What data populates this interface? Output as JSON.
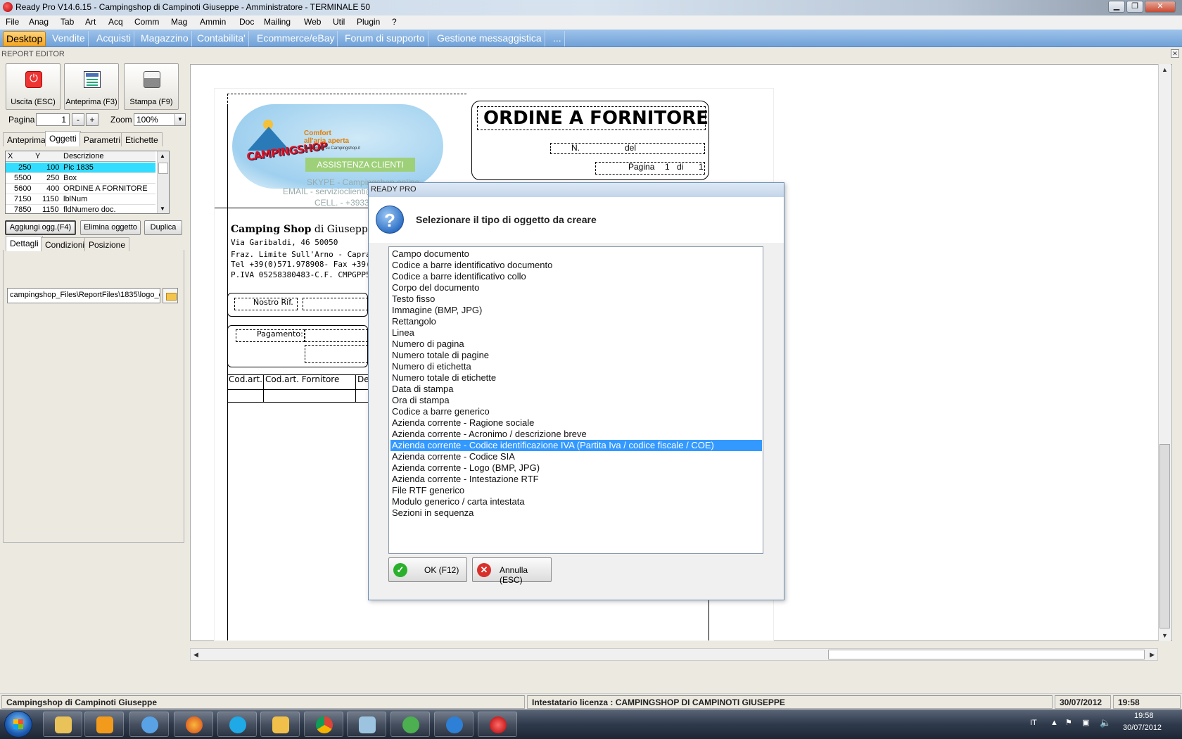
{
  "window": {
    "title": "Ready Pro V14.6.15 - Campingshop di Campinoti Giuseppe - Amministratore - TERMINALE 50"
  },
  "menubar": [
    "File",
    "Anag",
    "Tab",
    "Art",
    "Acq",
    "Comm",
    "Mag",
    "Ammin",
    "Doc",
    "Mailing",
    "Web",
    "Util",
    "Plugin",
    "?"
  ],
  "modules": [
    "Desktop",
    "Vendite",
    "Acquisti",
    "Magazzino",
    "Contabilita'",
    "Ecommerce/eBay",
    "Forum di supporto",
    "Gestione messaggistica",
    "..."
  ],
  "editor": {
    "label": "REPORT EDITOR"
  },
  "toolbar": {
    "exit": "Uscita (ESC)",
    "preview": "Anteprima (F3)",
    "print": "Stampa (F9)"
  },
  "pager": {
    "page_label": "Pagina",
    "page_value": "1",
    "minus": "-",
    "plus": "+",
    "zoom_label": "Zoom",
    "zoom_value": "100%"
  },
  "left_tabs": [
    "Anteprima",
    "Oggetti",
    "Parametri",
    "Etichette"
  ],
  "objects_grid": {
    "headers": [
      "X",
      "Y",
      "Descrizione"
    ],
    "rows": [
      {
        "x": "250",
        "y": "100",
        "desc": "Pic 1835"
      },
      {
        "x": "5500",
        "y": "250",
        "desc": "Box"
      },
      {
        "x": "5600",
        "y": "400",
        "desc": "ORDINE A FORNITORE"
      },
      {
        "x": "7150",
        "y": "1150",
        "desc": "lblNum"
      },
      {
        "x": "7850",
        "y": "1150",
        "desc": "fldNumero doc."
      }
    ]
  },
  "object_buttons": {
    "add": "Aggiungi ogg.(F4)",
    "delete": "Elimina oggetto",
    "dup": "Duplica"
  },
  "detail_tabs": [
    "Dettagli",
    "Condizioni",
    "Posizione"
  ],
  "path_value": "campingshop_Files\\ReportFiles\\1835\\logo_c",
  "report": {
    "title": "ORDINE A FORNITORE",
    "n_label": "N.",
    "del_label": "del",
    "pagina_label": "Pagina",
    "page_num": "1",
    "di_label": "di",
    "page_total": "1",
    "logo_word": "CAMPINGSHOP",
    "comfort": "Comfort\nall'aria aperta",
    "benvenuto": "Benvenuto su Campingshop.it",
    "assist": "ASSISTENZA CLIENTI",
    "skype": "SKYPE - Campingshop.online",
    "email": "EMAIL - servizioclienti@",
    "cell": "CELL. - +3933",
    "company_bold": "Camping Shop",
    "company_rest": " di Giuseppe C",
    "addr1": "Via Garibaldi, 46 50050",
    "addr2": "Fraz. Limite Sull'Arno - Capraia e Lin",
    "addr3": "Tel +39(0)571.978908- Fax +39(0)57",
    "addr4": "P.IVA 05258380483-C.F. CMPGPP59",
    "nostro_rif": "Nostro Rif.",
    "pagamento": "Pagamento:",
    "col1": "Cod.art.",
    "col2": "Cod.art. Fornitore",
    "col3": "De"
  },
  "dialog": {
    "title": "READY PRO",
    "message": "Selezionare il tipo di oggetto da creare",
    "items": [
      "Campo documento",
      "Codice a barre identificativo documento",
      "Codice a barre identificativo collo",
      "Corpo del documento",
      "Testo fisso",
      "Immagine (BMP, JPG)",
      "Rettangolo",
      "Linea",
      "Numero di pagina",
      "Numero totale di pagine",
      "Numero di etichetta",
      "Numero totale di etichette",
      "Data di stampa",
      "Ora di stampa",
      "Codice a barre generico",
      "Azienda corrente - Ragione sociale",
      "Azienda corrente - Acronimo / descrizione breve",
      "Azienda corrente - Codice identificazione IVA (Partita Iva / codice fiscale / COE)",
      "Azienda corrente - Codice SIA",
      "Azienda corrente - Logo (BMP, JPG)",
      "Azienda corrente - Intestazione RTF",
      "File RTF generico",
      "Modulo generico / carta intestata",
      "Sezioni in sequenza"
    ],
    "selected_index": 17,
    "ok": "OK (F12)",
    "cancel": "Annulla (ESC)"
  },
  "status": {
    "company": "Campingshop di Campinoti Giuseppe",
    "license": "Intestatario licenza : CAMPINGSHOP DI CAMPINOTI GIUSEPPE",
    "date": "30/07/2012",
    "time": "19:58"
  },
  "taskbar": {
    "lang": "IT",
    "clock_time": "19:58",
    "clock_date": "30/07/2012",
    "apps": [
      "file-explorer-icon",
      "media-player-icon",
      "itunes-icon",
      "firefox-icon",
      "skype-icon",
      "outlook-icon",
      "chrome-icon",
      "notes-icon",
      "settings-icon",
      "internet-explorer-icon",
      "ready-pro-icon"
    ]
  }
}
